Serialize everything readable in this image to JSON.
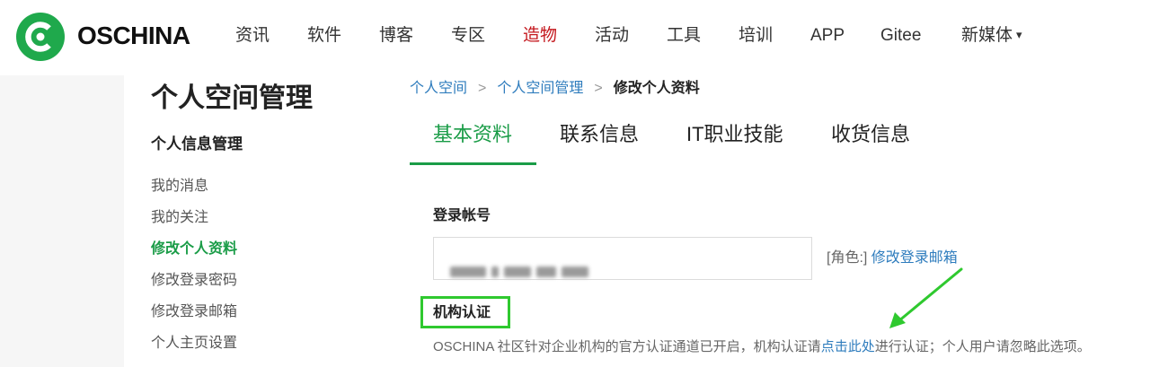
{
  "header": {
    "brand": "OSCHINA",
    "nav": [
      {
        "label": "资讯"
      },
      {
        "label": "软件"
      },
      {
        "label": "博客"
      },
      {
        "label": "专区"
      },
      {
        "label": "造物"
      },
      {
        "label": "活动"
      },
      {
        "label": "工具"
      },
      {
        "label": "培训"
      },
      {
        "label": "APP"
      },
      {
        "label": "Gitee"
      },
      {
        "label": "新媒体"
      }
    ],
    "caret": "▾",
    "active_nav": "造物",
    "brand_color": "#1fa94c",
    "active_color": "#c4171d"
  },
  "sidebar": {
    "title": "个人空间管理",
    "section": "个人信息管理",
    "items": [
      {
        "label": "我的消息"
      },
      {
        "label": "我的关注"
      },
      {
        "label": "修改个人资料"
      },
      {
        "label": "修改登录密码"
      },
      {
        "label": "修改登录邮箱"
      },
      {
        "label": "个人主页设置"
      }
    ],
    "active_item": "修改个人资料"
  },
  "breadcrumb": {
    "items": [
      "个人空间",
      "个人空间管理",
      "修改个人资料"
    ],
    "separator": ">"
  },
  "tabs": {
    "items": [
      {
        "label": "基本资料"
      },
      {
        "label": "联系信息"
      },
      {
        "label": "IT职业技能"
      },
      {
        "label": "收货信息"
      }
    ],
    "active": "基本资料"
  },
  "form": {
    "account_label": "登录帐号",
    "account_value_note": "blurred",
    "role_prefix": "[角色:]",
    "role_link": "修改登录邮箱",
    "org_label": "机构认证",
    "desc_before": "OSCHINA 社区针对企业机构的官方认证通道已开启，机构认证请",
    "desc_link": "点击此处",
    "desc_after": "进行认证；个人用户请忽略此选项。"
  },
  "annotation_color": "#2fc92f",
  "link_color": "#2e7cbd"
}
